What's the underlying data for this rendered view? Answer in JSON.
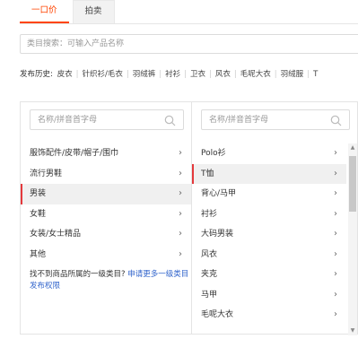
{
  "tabs": [
    {
      "label": "一口价",
      "active": true
    },
    {
      "label": "拍卖",
      "active": false
    }
  ],
  "category_search": {
    "placeholder": "类目搜索：可输入产品名称"
  },
  "history": {
    "label": "发布历史:",
    "items": [
      "皮衣",
      "针织衫/毛衣",
      "羽绒裤",
      "衬衫",
      "卫衣",
      "风衣",
      "毛呢大衣",
      "羽绒服",
      "T"
    ]
  },
  "left_panel": {
    "search_placeholder": "名称/拼音首字母",
    "items": [
      {
        "label": "服饰配件/皮带/帽子/围巾",
        "selected": false
      },
      {
        "label": "流行男鞋",
        "selected": false
      },
      {
        "label": "男装",
        "selected": true
      },
      {
        "label": "女鞋",
        "selected": false
      },
      {
        "label": "女装/女士精品",
        "selected": false
      },
      {
        "label": "其他",
        "selected": false
      }
    ],
    "help_text": "找不到商品所属的一级类目?",
    "help_link": "申请更多一级类目发布权限"
  },
  "right_panel": {
    "search_placeholder": "名称/拼音首字母",
    "items": [
      {
        "label": "Polo衫",
        "selected": false
      },
      {
        "label": "T恤",
        "selected": true
      },
      {
        "label": "背心/马甲",
        "selected": false
      },
      {
        "label": "衬衫",
        "selected": false
      },
      {
        "label": "大码男装",
        "selected": false
      },
      {
        "label": "风衣",
        "selected": false
      },
      {
        "label": "夹克",
        "selected": false
      },
      {
        "label": "马甲",
        "selected": false
      },
      {
        "label": "毛呢大衣",
        "selected": false
      }
    ]
  },
  "icons": {
    "chevron": "chevron-right-icon",
    "search": "search-icon",
    "scroll_up": "scroll-up-arrow-icon",
    "scroll_down": "scroll-down-arrow-icon"
  },
  "colors": {
    "accent": "#ff4400",
    "selected_bar": "#e4393c",
    "link": "#3366cc"
  }
}
